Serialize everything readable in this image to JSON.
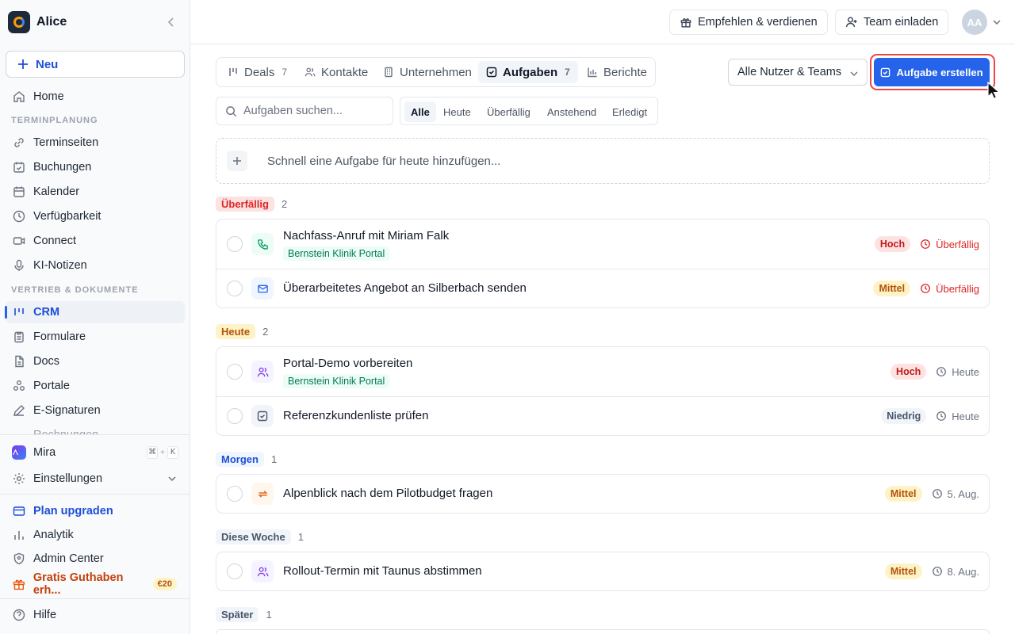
{
  "workspace": {
    "name": "Alice"
  },
  "sidebar": {
    "new_label": "Neu",
    "home": "Home",
    "section_scheduling": "TERMINPLANUNG",
    "scheduling_items": [
      "Terminseiten",
      "Buchungen",
      "Kalender",
      "Verfügbarkeit",
      "Connect",
      "KI-Notizen"
    ],
    "section_sales": "VERTRIEB & DOKUMENTE",
    "sales_items": [
      "CRM",
      "Formulare",
      "Docs",
      "Portale",
      "E-Signaturen"
    ],
    "cutoff_item": "Rechnungen",
    "mira": {
      "label": "Mira",
      "shortcut": [
        "⌘",
        "+",
        "K"
      ]
    },
    "settings": "Einstellungen",
    "upgrade": "Plan upgraden",
    "analytics": "Analytik",
    "admin": "Admin Center",
    "credits": {
      "label": "Gratis Guthaben erh...",
      "badge": "€20"
    },
    "help": "Hilfe"
  },
  "header": {
    "refer": "Empfehlen & verdienen",
    "invite": "Team einladen",
    "avatar": "AA"
  },
  "tabs": [
    {
      "label": "Deals",
      "count": "7"
    },
    {
      "label": "Kontakte",
      "count": ""
    },
    {
      "label": "Unternehmen",
      "count": ""
    },
    {
      "label": "Aufgaben",
      "count": "7"
    },
    {
      "label": "Berichte",
      "count": ""
    }
  ],
  "team_select": "Alle Nutzer & Teams",
  "create_task": "Aufgabe erstellen",
  "search_placeholder": "Aufgaben suchen...",
  "filters": [
    "Alle",
    "Heute",
    "Überfällig",
    "Anstehend",
    "Erledigt"
  ],
  "quick_add_placeholder": "Schnell eine Aufgabe für heute hinzufügen...",
  "groups": [
    {
      "label": "Überfällig",
      "count": "2",
      "color": "#dc2626",
      "tasks": [
        {
          "title": "Nachfass-Anruf mit Miriam Falk",
          "tag": "Bernstein Klinik Portal",
          "icon": "phone-icon",
          "priority": "Hoch",
          "due": "Überfällig"
        },
        {
          "title": "Überarbeitetes Angebot an Silberbach senden",
          "tag": "",
          "icon": "mail-icon",
          "priority": "Mittel",
          "due": "Überfällig"
        }
      ]
    },
    {
      "label": "Heute",
      "count": "2",
      "color": "#b45309",
      "tasks": [
        {
          "title": "Portal-Demo vorbereiten",
          "tag": "Bernstein Klinik Portal",
          "icon": "users-icon",
          "priority": "Hoch",
          "due": "Heute"
        },
        {
          "title": "Referenzkundenliste prüfen",
          "tag": "",
          "icon": "checkbox-icon",
          "priority": "Niedrig",
          "due": "Heute"
        }
      ]
    },
    {
      "label": "Morgen",
      "count": "1",
      "color": "#1d4ed8",
      "tasks": [
        {
          "title": "Alpenblick nach dem Pilotbudget fragen",
          "tag": "",
          "icon": "repeat-icon",
          "priority": "Mittel",
          "due": "5. Aug."
        }
      ]
    },
    {
      "label": "Diese Woche",
      "count": "1",
      "color": "#475569",
      "tasks": [
        {
          "title": "Rollout-Termin mit Taunus abstimmen",
          "tag": "",
          "icon": "users-icon",
          "priority": "Mittel",
          "due": "8. Aug."
        }
      ]
    },
    {
      "label": "Später",
      "count": "1",
      "color": "#475569",
      "tasks": []
    }
  ]
}
